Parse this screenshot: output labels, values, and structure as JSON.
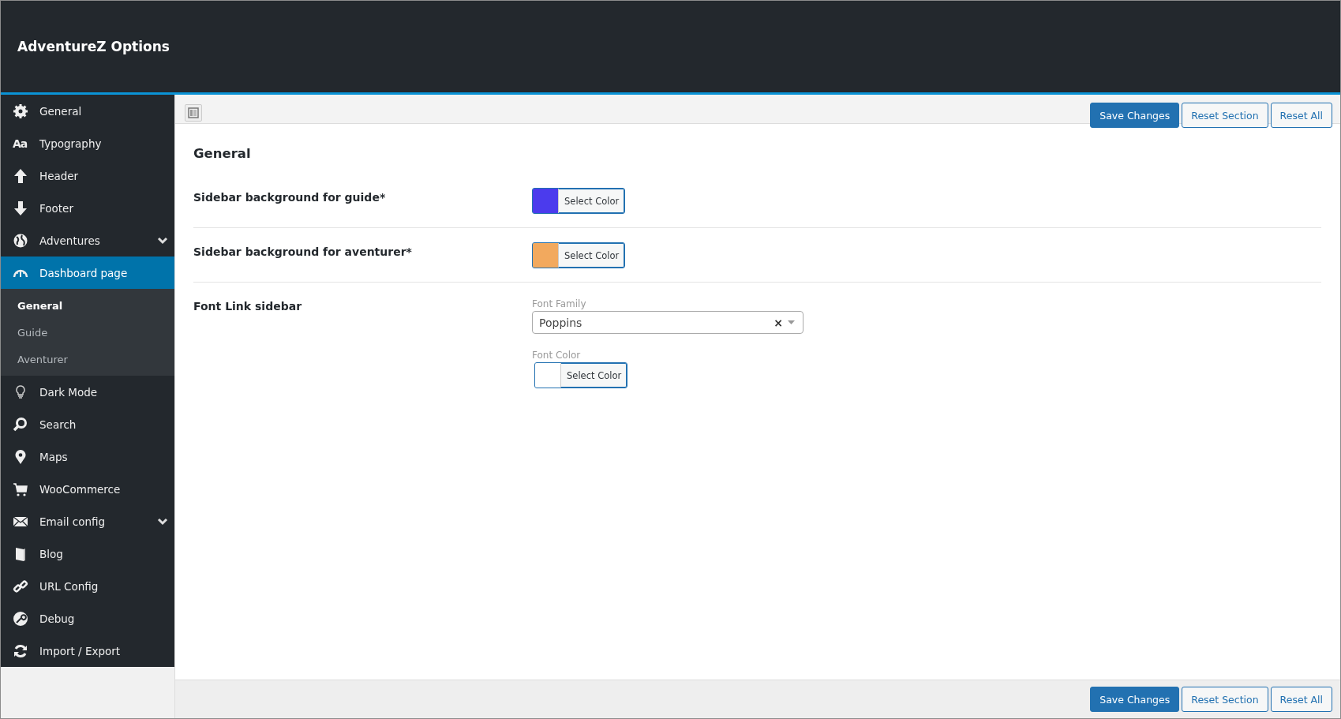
{
  "header": {
    "title": "AdventureZ Options"
  },
  "sidebar": {
    "items": [
      {
        "label": "General",
        "selected": false,
        "expandable": false
      },
      {
        "label": "Typography",
        "icon_text": "Aa",
        "selected": false,
        "expandable": false
      },
      {
        "label": "Header",
        "selected": false,
        "expandable": false
      },
      {
        "label": "Footer",
        "selected": false,
        "expandable": false
      },
      {
        "label": "Adventures",
        "selected": false,
        "expandable": true
      },
      {
        "label": "Dashboard page",
        "selected": true,
        "expandable": false,
        "children": [
          {
            "label": "General",
            "selected": true
          },
          {
            "label": "Guide",
            "selected": false
          },
          {
            "label": "Aventurer",
            "selected": false
          }
        ]
      },
      {
        "label": "Dark Mode",
        "selected": false,
        "expandable": false
      },
      {
        "label": "Search",
        "selected": false,
        "expandable": false
      },
      {
        "label": "Maps",
        "selected": false,
        "expandable": false
      },
      {
        "label": "WooCommerce",
        "selected": false,
        "expandable": false
      },
      {
        "label": "Email config",
        "selected": false,
        "expandable": true
      },
      {
        "label": "Blog",
        "selected": false,
        "expandable": false
      },
      {
        "label": "URL Config",
        "selected": false,
        "expandable": false
      },
      {
        "label": "Debug",
        "selected": false,
        "expandable": false
      },
      {
        "label": "Import / Export",
        "selected": false,
        "expandable": false
      }
    ]
  },
  "top_buttons": [
    {
      "label": "Save Changes",
      "kind": "primary"
    },
    {
      "label": "Reset Section",
      "kind": "secondary"
    },
    {
      "label": "Reset All",
      "kind": "secondary"
    }
  ],
  "section": {
    "title": "General",
    "fields": [
      {
        "kind": "color",
        "label": "Sidebar background for guide*",
        "color": "#4b3bed",
        "button": "Select Color"
      },
      {
        "kind": "color",
        "label": "Sidebar background for aventurer*",
        "color": "#f2a95e",
        "button": "Select Color"
      },
      {
        "kind": "font",
        "label": "Font Link sidebar",
        "family_label": "Font Family",
        "family_value": "Poppins",
        "clear": "×",
        "color_label": "Font Color",
        "color": "#ffffff",
        "button": "Select Color"
      }
    ]
  },
  "bottom_buttons": [
    {
      "label": "Save Changes",
      "kind": "primary"
    },
    {
      "label": "Reset Section",
      "kind": "secondary"
    },
    {
      "label": "Reset All",
      "kind": "secondary"
    }
  ]
}
